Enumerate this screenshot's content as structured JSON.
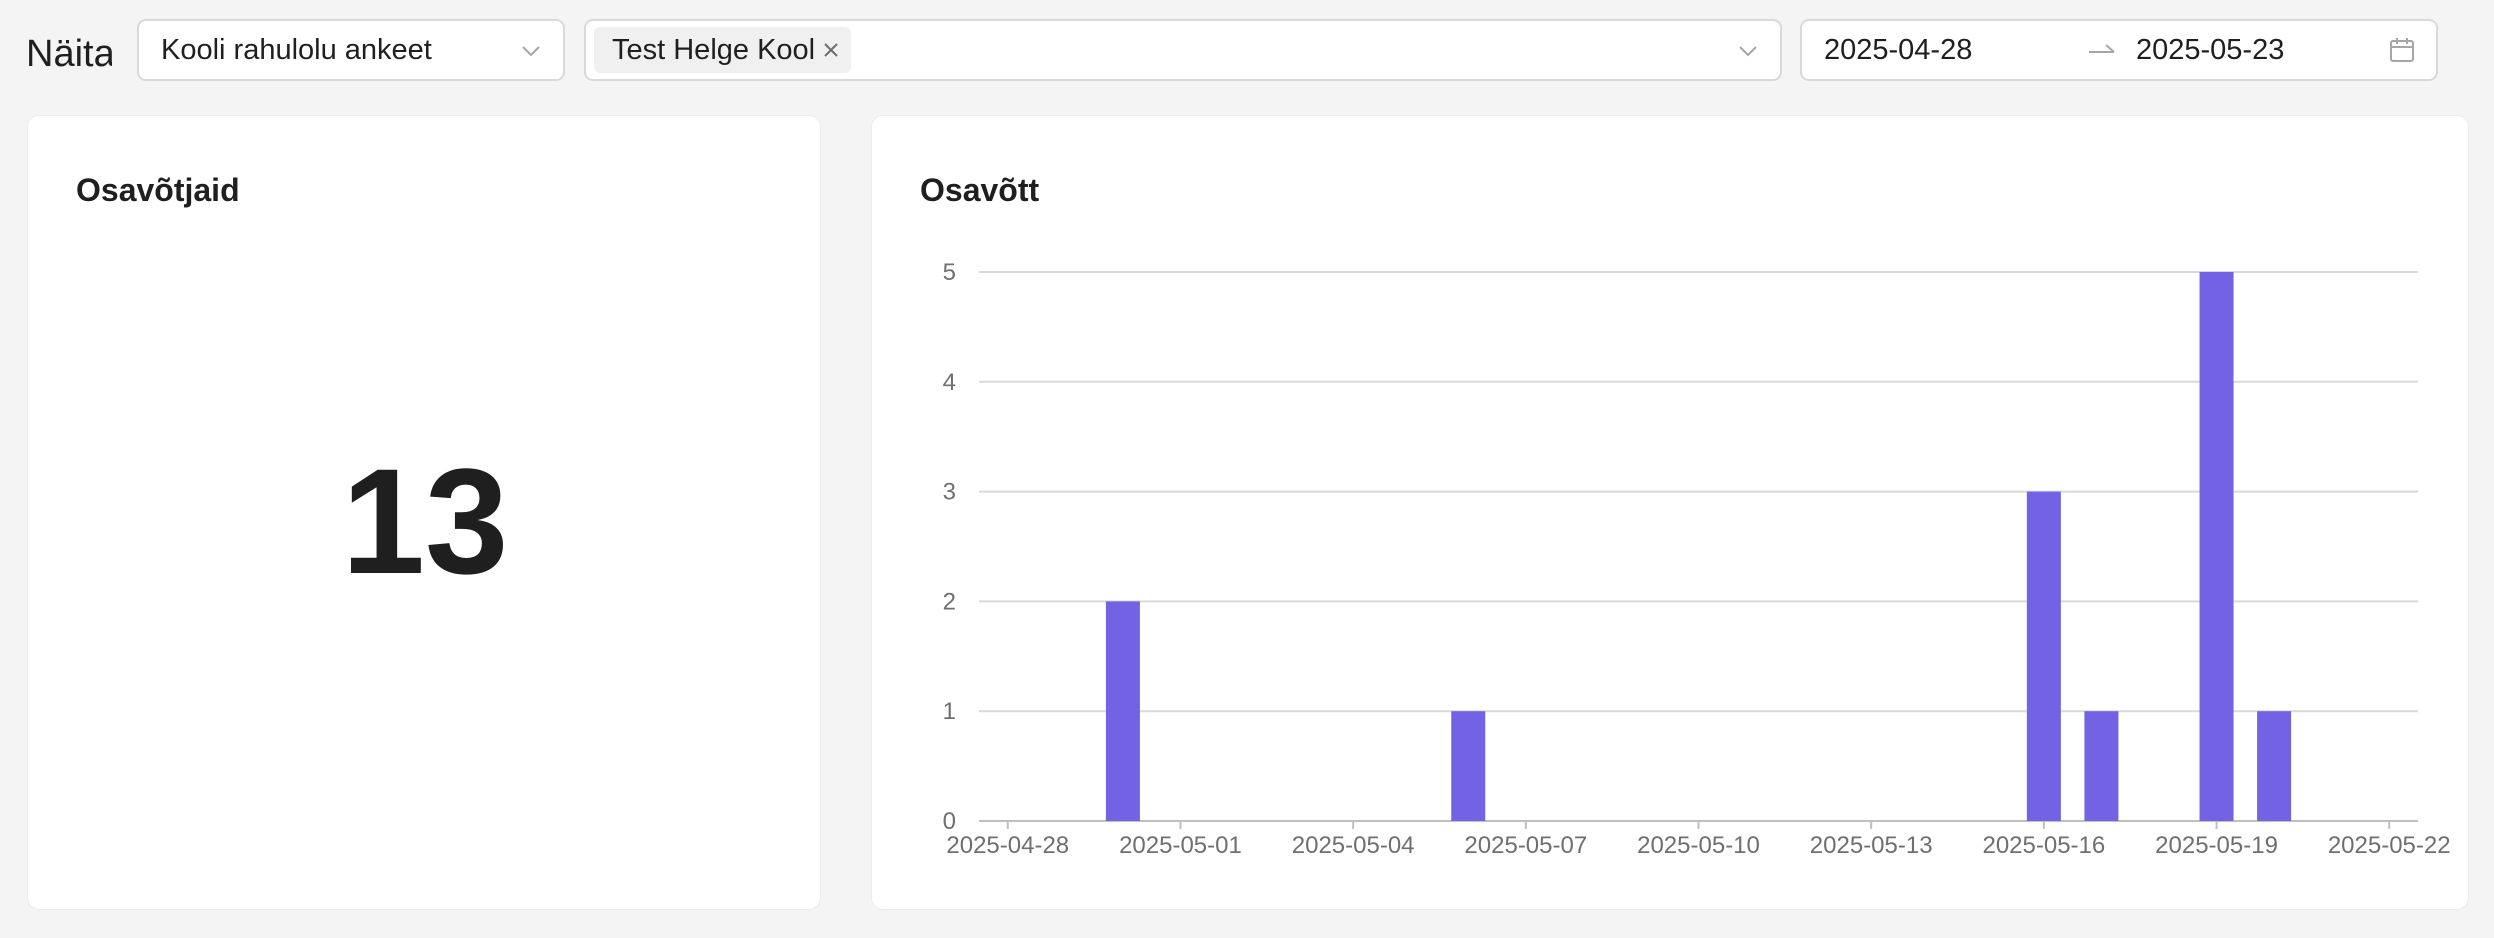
{
  "toolbar": {
    "show_label": "Näita",
    "survey_select": "Kooli rahulolu ankeet",
    "school_tag": "Test Helge Kool",
    "date_start": "2025-04-28",
    "date_end": "2025-05-23"
  },
  "participants_card": {
    "title": "Osavõtjaid",
    "value": "13"
  },
  "participation_card": {
    "title": "Osavõtt"
  },
  "colors": {
    "bar": "#7163e3",
    "grid": "#d9d9d9",
    "axis": "#bfbfbf"
  },
  "chart_data": {
    "type": "bar",
    "title": "Osavõtt",
    "x": [
      "2025-04-30",
      "2025-05-06",
      "2025-05-16",
      "2025-05-17",
      "2025-05-19",
      "2025-05-20"
    ],
    "values": [
      2,
      1,
      3,
      1,
      5,
      1
    ],
    "x_range": [
      "2025-04-28",
      "2025-05-23"
    ],
    "x_ticks": [
      "2025-04-28",
      "2025-05-01",
      "2025-05-04",
      "2025-05-07",
      "2025-05-10",
      "2025-05-13",
      "2025-05-16",
      "2025-05-19",
      "2025-05-22"
    ],
    "y_ticks": [
      "0",
      "1",
      "2",
      "3",
      "4",
      "5"
    ],
    "ylim": [
      0,
      5
    ],
    "grid": true,
    "legend": "none"
  }
}
